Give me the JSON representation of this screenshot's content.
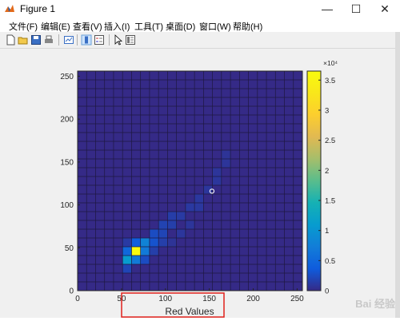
{
  "window": {
    "title": "Figure 1",
    "minimize": "—",
    "maximize": "☐",
    "close": "✕"
  },
  "menu": [
    "文件(F)",
    "编辑(E)",
    "查看(V)",
    "插入(I)",
    "工具(T)",
    "桌面(D)",
    "窗口(W)",
    "帮助(H)"
  ],
  "toolbar_icons": [
    "new-figure-icon",
    "open-file-icon",
    "save-icon",
    "print-icon",
    "link-plot-icon",
    "insert-colorbar-icon",
    "insert-legend-icon",
    "edit-plot-icon",
    "property-inspector-icon"
  ],
  "watermark": "Bai 经验",
  "chart_data": {
    "type": "heatmap",
    "title": "",
    "xlabel": "Red Values",
    "ylabel": "",
    "xlim": [
      0,
      256
    ],
    "ylim": [
      0,
      256
    ],
    "xticks": [
      "0",
      "50",
      "100",
      "150",
      "200",
      "250"
    ],
    "yticks": [
      "0",
      "50",
      "100",
      "150",
      "200",
      "250"
    ],
    "bin_width": 10.24,
    "grid_bins": 25,
    "colorbar": {
      "range": [
        0,
        36500
      ],
      "multiplier": "×10⁴",
      "ticks": [
        "0",
        "0.5",
        "1",
        "1.5",
        "2",
        "2.5",
        "3",
        "3.5"
      ],
      "colormap": "parula"
    },
    "background_value": 0,
    "cells": [
      {
        "x": 51.2,
        "y": 30.72,
        "value": 11000
      },
      {
        "x": 61.44,
        "y": 30.72,
        "value": 7000
      },
      {
        "x": 51.2,
        "y": 40.96,
        "value": 5000
      },
      {
        "x": 61.44,
        "y": 40.96,
        "value": 36500
      },
      {
        "x": 71.68,
        "y": 40.96,
        "value": 7000
      },
      {
        "x": 71.68,
        "y": 51.2,
        "value": 8000
      },
      {
        "x": 61.44,
        "y": 51.2,
        "value": 4000
      },
      {
        "x": 81.92,
        "y": 51.2,
        "value": 3000
      },
      {
        "x": 81.92,
        "y": 61.44,
        "value": 2500
      },
      {
        "x": 92.16,
        "y": 61.44,
        "value": 2000
      },
      {
        "x": 92.16,
        "y": 71.68,
        "value": 1800
      },
      {
        "x": 102.4,
        "y": 71.68,
        "value": 1500
      },
      {
        "x": 102.4,
        "y": 81.92,
        "value": 1400
      },
      {
        "x": 112.64,
        "y": 81.92,
        "value": 1200
      },
      {
        "x": 122.88,
        "y": 92.16,
        "value": 1100
      },
      {
        "x": 133.12,
        "y": 92.16,
        "value": 1000
      },
      {
        "x": 133.12,
        "y": 102.4,
        "value": 1000
      },
      {
        "x": 143.36,
        "y": 112.64,
        "value": 900
      },
      {
        "x": 153.6,
        "y": 122.88,
        "value": 900
      },
      {
        "x": 153.6,
        "y": 133.12,
        "value": 800
      },
      {
        "x": 163.84,
        "y": 143.36,
        "value": 800
      },
      {
        "x": 163.84,
        "y": 153.6,
        "value": 700
      },
      {
        "x": 51.2,
        "y": 20.48,
        "value": 2000
      },
      {
        "x": 71.68,
        "y": 30.72,
        "value": 2500
      },
      {
        "x": 92.16,
        "y": 51.2,
        "value": 1500
      },
      {
        "x": 81.92,
        "y": 40.96,
        "value": 1500
      },
      {
        "x": 51.2,
        "y": 51.2,
        "value": 1200
      },
      {
        "x": 112.64,
        "y": 61.44,
        "value": 900
      },
      {
        "x": 122.88,
        "y": 71.68,
        "value": 800
      },
      {
        "x": 102.4,
        "y": 51.2,
        "value": 700
      }
    ],
    "marker": {
      "x": 153,
      "y": 116
    }
  }
}
